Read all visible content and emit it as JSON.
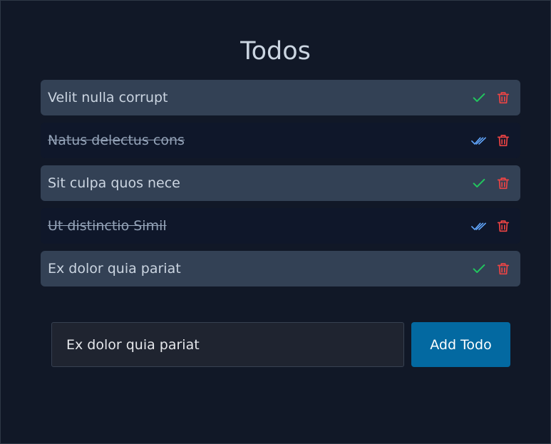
{
  "app": {
    "title": "Todos"
  },
  "todos": [
    {
      "text": "Velit nulla corrupt",
      "completed": false
    },
    {
      "text": "Natus delectus cons",
      "completed": true
    },
    {
      "text": "Sit culpa quos nece",
      "completed": false
    },
    {
      "text": "Ut distinctio Simil",
      "completed": true
    },
    {
      "text": "Ex dolor quia pariat",
      "completed": false
    }
  ],
  "icons": {
    "pending_toggle": "check-icon",
    "completed_toggle": "double-check-icon",
    "delete": "trash-icon"
  },
  "form": {
    "input_value": "Ex dolor quia pariat",
    "add_label": "Add Todo"
  },
  "colors": {
    "background": "#111827",
    "pending_row": "#334155",
    "completed_row": "#0f172a",
    "check_green": "#22c55e",
    "double_check_blue": "#60a5fa",
    "trash_red": "#ef4444",
    "button_blue": "#0369a1"
  }
}
